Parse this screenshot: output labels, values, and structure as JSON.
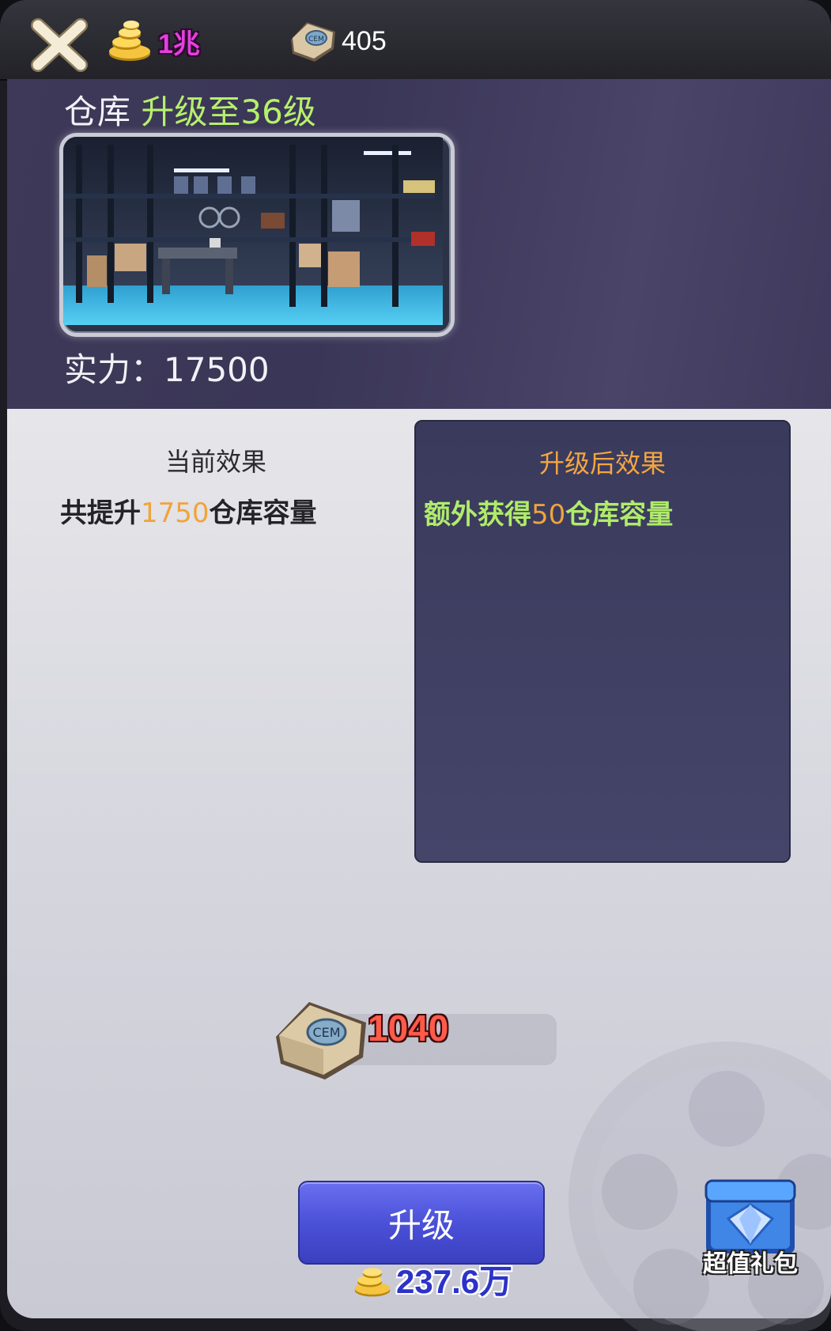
{
  "topbar": {
    "gold_value": "1兆",
    "cement_value": "405"
  },
  "header": {
    "building_name": "仓库",
    "upgrade_text": "升级至36级",
    "power_label": "实力：",
    "power_value": "17500"
  },
  "current_effect": {
    "title": "当前效果",
    "desc_prefix": "共提升",
    "desc_value": "1750",
    "desc_suffix": "仓库容量"
  },
  "next_effect": {
    "title": "升级后效果",
    "desc_prefix": "额外获得",
    "desc_value": "50",
    "desc_suffix": "仓库容量"
  },
  "cost": {
    "cement_required": "1040"
  },
  "upgrade_button": {
    "label": "升级",
    "gold_price": "237.6万"
  },
  "gift_pack": {
    "label": "超值礼包"
  },
  "colors": {
    "level_green": "#b6f06a",
    "number_orange": "#f0a43a",
    "gold_magenta": "#e53fe0",
    "cost_red": "#ff5a4a",
    "button_blue": "#4b51d8"
  },
  "icons": [
    "close-icon",
    "gold-coins-icon",
    "cement-bag-icon",
    "gift-chest-icon",
    "film-reel-decoration"
  ]
}
